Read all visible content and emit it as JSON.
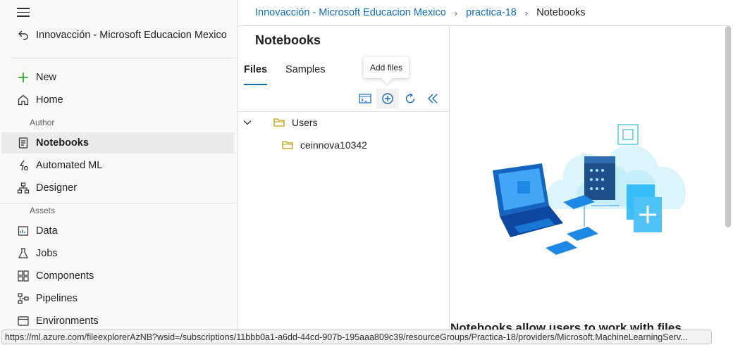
{
  "breadcrumb": {
    "items": [
      "Innovacción - Microsoft Educacion Mexico",
      "practica-18",
      "Notebooks"
    ]
  },
  "workspace": {
    "name": "Innovacción - Microsoft Educacion Mexico"
  },
  "nav": {
    "new": "New",
    "home": "Home",
    "author_section": "Author",
    "notebooks": "Notebooks",
    "automated_ml": "Automated ML",
    "designer": "Designer",
    "assets_section": "Assets",
    "data": "Data",
    "jobs": "Jobs",
    "components": "Components",
    "pipelines": "Pipelines",
    "environments": "Environments"
  },
  "panel": {
    "title": "Notebooks",
    "tabs": [
      "Files",
      "Samples"
    ],
    "tooltip": "Add files",
    "tree": [
      {
        "label": "Users"
      },
      {
        "label": "ceinnova10342"
      }
    ]
  },
  "content": {
    "heading": "Notebooks allow users to work with files"
  },
  "status_url": "https://ml.azure.com/fileexplorerAzNB?wsid=/subscriptions/11bbb0a1-a6dd-44cd-907b-195aaa809c39/resourceGroups/Practica-18/providers/Microsoft.MachineLearningServ...",
  "colors": {
    "accent": "#0f6cbd",
    "folder": "#c19c00",
    "new_plus": "#13a10e"
  }
}
